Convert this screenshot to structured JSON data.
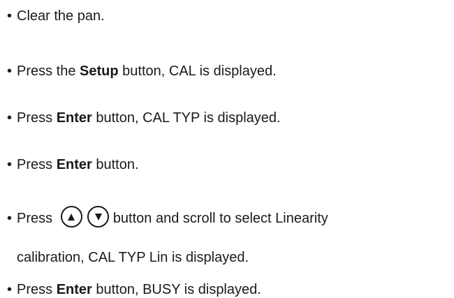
{
  "steps": {
    "s1": {
      "text": "Clear the pan."
    },
    "s2": {
      "pre": "Press the ",
      "bold": "Setup",
      "post": " button, CAL is displayed."
    },
    "s3": {
      "pre": "Press ",
      "bold": "Enter",
      "post": " button, CAL TYP is displayed."
    },
    "s4": {
      "pre": "Press ",
      "bold": "Enter",
      "post": " button."
    },
    "s5": {
      "pre": "Press",
      "post": "button and scroll to select Linearity",
      "continuation": "calibration, CAL TYP Lin is displayed.",
      "up_icon": "up-arrow-icon",
      "down_icon": "down-arrow-icon"
    },
    "s6": {
      "pre": "Press ",
      "bold": "Enter",
      "post": " button, BUSY is displayed."
    }
  },
  "bullet_char": "•"
}
